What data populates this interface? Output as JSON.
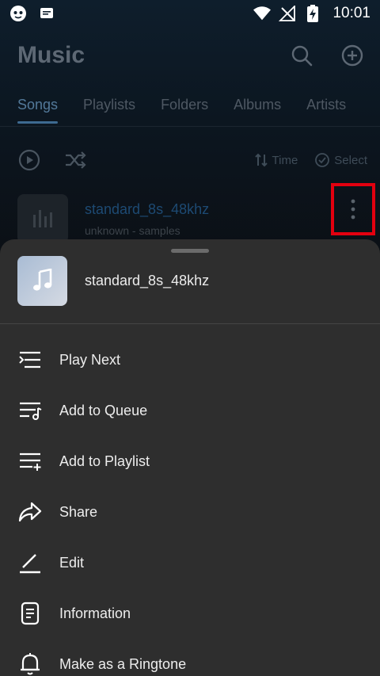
{
  "status_bar": {
    "time": "10:01",
    "left_icons": [
      "app-face-icon",
      "message-icon"
    ],
    "right_icons": [
      "wifi-icon",
      "no-signal-icon",
      "battery-charging-icon"
    ]
  },
  "app": {
    "title": "Music",
    "actions": [
      "search-icon",
      "add-circle-icon"
    ],
    "tabs": [
      {
        "label": "Songs",
        "active": true
      },
      {
        "label": "Playlists"
      },
      {
        "label": "Folders"
      },
      {
        "label": "Albums"
      },
      {
        "label": "Artists"
      }
    ],
    "toolbar": {
      "sort_label": "Time",
      "select_label": "Select"
    },
    "song": {
      "title": "standard_8s_48khz",
      "subtitle": "unknown - samples"
    }
  },
  "sheet": {
    "title": "standard_8s_48khz",
    "items": [
      {
        "label": "Play Next",
        "icon": "play-next-icon"
      },
      {
        "label": "Add to Queue",
        "icon": "queue-music-icon"
      },
      {
        "label": "Add to Playlist",
        "icon": "playlist-add-icon"
      },
      {
        "label": "Share",
        "icon": "share-icon"
      },
      {
        "label": "Edit",
        "icon": "edit-icon"
      },
      {
        "label": "Information",
        "icon": "information-icon"
      },
      {
        "label": "Make as a Ringtone",
        "icon": "bell-icon"
      }
    ]
  },
  "colors": {
    "sheet_bg": "#2e2e2e",
    "highlight_box": "#e3000f",
    "active_tab": "#53799a"
  }
}
